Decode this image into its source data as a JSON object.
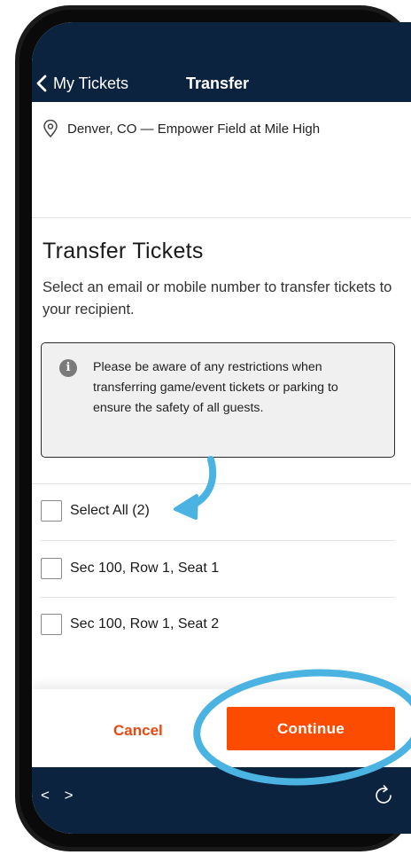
{
  "nav": {
    "back_label": "My Tickets",
    "title": "Transfer"
  },
  "event": {
    "location": "Denver, CO — Empower Field at Mile High"
  },
  "main": {
    "heading": "Transfer Tickets",
    "subtext": "Select an email or mobile number to transfer tickets to your recipient.",
    "notice_icon": "i",
    "notice": "Please be aware of any restrictions when transferring game/event tickets or parking to ensure the safety of all guests."
  },
  "tickets": {
    "select_all": "Select All (2)",
    "items": [
      {
        "label": "Sec 100, Row 1, Seat 1"
      },
      {
        "label": "Sec 100, Row 1, Seat 2"
      }
    ]
  },
  "footer": {
    "cancel_label": "Cancel",
    "continue_label": "Continue"
  },
  "bottom_nav": {
    "arrows": "< >"
  },
  "colors": {
    "navy": "#0c2340",
    "orange": "#fc4c02",
    "annotation_blue": "#4ab3e2"
  },
  "icons": [
    "chevron-left-icon",
    "location-pin-icon",
    "info-icon",
    "refresh-icon",
    "arrow-annotation",
    "circle-annotation"
  ]
}
